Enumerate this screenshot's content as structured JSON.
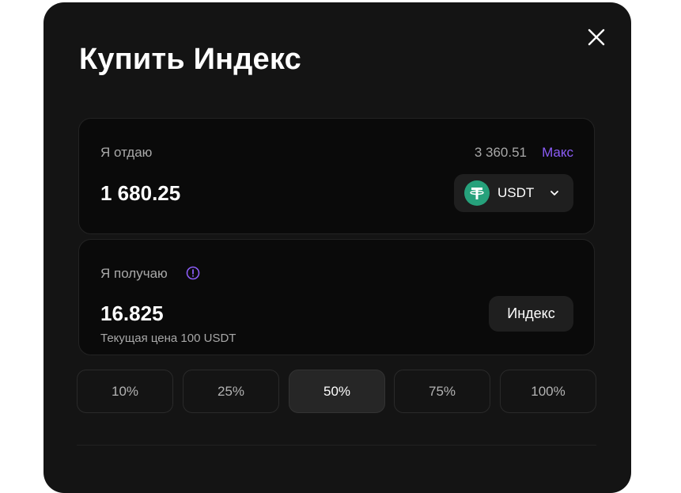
{
  "dialog": {
    "title": "Купить Индекс"
  },
  "give": {
    "label": "Я отдаю",
    "balance": "3 360.51",
    "max_label": "Макс",
    "amount": "1 680.25",
    "token": {
      "name": "USDT",
      "icon": "tether-icon",
      "color": "#26a17b"
    }
  },
  "receive": {
    "label": "Я получаю",
    "amount": "16.825",
    "note": "Текущая цена 100 USDT",
    "asset_label": "Индекс"
  },
  "percent_options": [
    {
      "label": "10%",
      "active": false
    },
    {
      "label": "25%",
      "active": false
    },
    {
      "label": "50%",
      "active": true
    },
    {
      "label": "75%",
      "active": false
    },
    {
      "label": "100%",
      "active": false
    }
  ],
  "colors": {
    "accent": "#8b5cf6",
    "background": "#141414",
    "card": "#0a0a0a"
  }
}
